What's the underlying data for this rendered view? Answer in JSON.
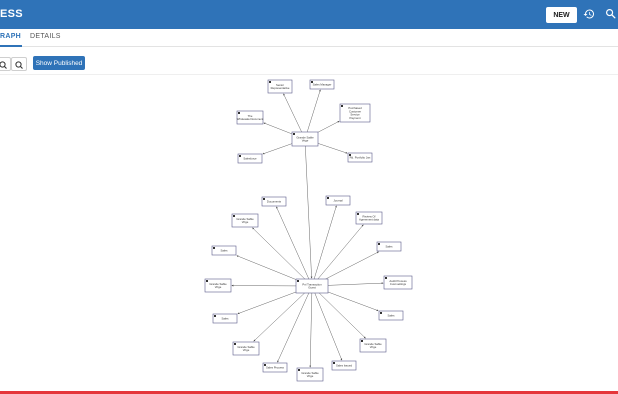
{
  "header": {
    "title": "ESS",
    "new_label": "NEW",
    "history_icon": "history-icon",
    "search_icon": "search-icon"
  },
  "tabs": [
    {
      "label": "RAPH",
      "active": true
    },
    {
      "label": "DETAILS",
      "active": false
    }
  ],
  "toolbar": {
    "zoom_in_icon": "zoom-in-icon",
    "zoom_out_icon": "zoom-out-icon",
    "show_published_label": "Show Published"
  },
  "graph": {
    "nodes": [
      {
        "id": "top-hub",
        "label": [
          "Grande Sable",
          "Vrtge"
        ]
      },
      {
        "id": "t1",
        "label": [
          "Senior",
          "Representative"
        ]
      },
      {
        "id": "t2",
        "label": [
          "Sales Manager"
        ]
      },
      {
        "id": "t3",
        "label": [
          "The",
          "Wholesale Document"
        ]
      },
      {
        "id": "t4",
        "label": [
          "Purchased",
          "Customer",
          "Service",
          "Payment"
        ]
      },
      {
        "id": "t5",
        "label": [
          "Salesforce"
        ]
      },
      {
        "id": "t6",
        "label": [
          "Rd. Portfolio Jan"
        ]
      },
      {
        "id": "bottom-hub",
        "label": [
          "Pnl Transaction",
          "Guest"
        ]
      },
      {
        "id": "b1",
        "label": [
          "Documents"
        ]
      },
      {
        "id": "b2",
        "label": [
          "Journal"
        ]
      },
      {
        "id": "b3",
        "label": [
          "Grande Sable",
          "Vrtge"
        ]
      },
      {
        "id": "b4",
        "label": [
          "Review Of",
          "Agreement data"
        ]
      },
      {
        "id": "b5",
        "label": [
          "Sales"
        ]
      },
      {
        "id": "b6",
        "label": [
          "Sales"
        ]
      },
      {
        "id": "b7",
        "label": [
          "Grande Sable",
          "Vrtge"
        ]
      },
      {
        "id": "b8",
        "label": [
          "Audit Process",
          "Cust settings"
        ]
      },
      {
        "id": "b9",
        "label": [
          "Sales"
        ]
      },
      {
        "id": "b10",
        "label": [
          "Sales"
        ]
      },
      {
        "id": "b11",
        "label": [
          "Grande Sable",
          "Vrtge"
        ]
      },
      {
        "id": "b12",
        "label": [
          "Grande Sable",
          "Vrtge"
        ]
      },
      {
        "id": "b13",
        "label": [
          "Sales Process"
        ]
      },
      {
        "id": "b14",
        "label": [
          "Grande Sable",
          "Vrtge"
        ]
      },
      {
        "id": "b15",
        "label": [
          "Sales Issued"
        ]
      }
    ]
  }
}
